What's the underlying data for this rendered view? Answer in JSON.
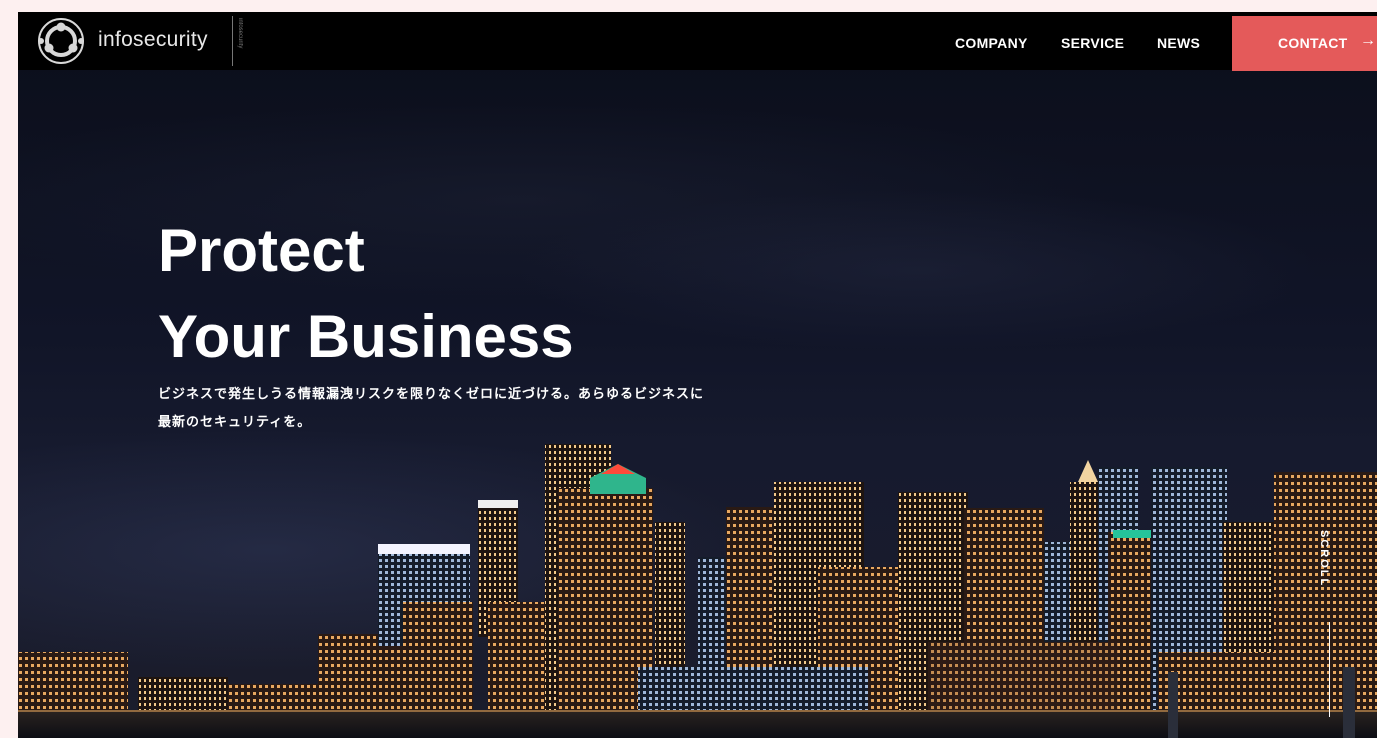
{
  "header": {
    "logo_text": "infosecurity",
    "logo_tagline": "infosecurity",
    "nav": [
      {
        "label": "COMPANY"
      },
      {
        "label": "SERVICE"
      },
      {
        "label": "NEWS"
      }
    ],
    "contact": {
      "label": "CONTACT",
      "arrow": "→"
    }
  },
  "hero": {
    "title_line1": "Protect",
    "title_line2": "Your Business",
    "subtitle_line1": "ビジネスで発生しうる情報漏洩リスクを限りなくゼロに近づける。あらゆるビジネスに",
    "subtitle_line2": "最新のセキュリティを。"
  },
  "scroll": {
    "label": "SCROLL"
  },
  "colors": {
    "accent": "#e45a5a",
    "header_bg": "#000000",
    "text": "#ffffff"
  }
}
